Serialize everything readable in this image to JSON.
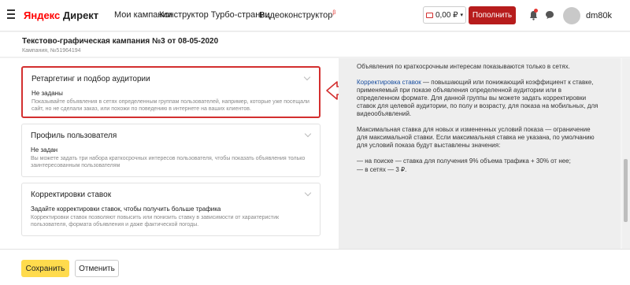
{
  "header": {
    "logo_brand": "Яндекс",
    "logo_product": "Директ",
    "nav": [
      "Мои кампании",
      "Конструктор Турбо-страниц",
      "Видеоконструктор"
    ],
    "nav_badge": "β",
    "balance": "0,00 ₽",
    "topup_label": "Пополнить",
    "username": "dm80k"
  },
  "campaign": {
    "title": "Текстово-графическая кампания №3 от 08-05-2020",
    "subtitle": "Кампания, №51964194"
  },
  "cards": [
    {
      "title": "Ретаргетинг и подбор аудитории",
      "status": "Не заданы",
      "desc": "Показывайте объявления в сетях определенным группам пользователей, например, которые уже посещали сайт, но не сделали заказ, или похожи по поведению в интернете на ваших клиентов."
    },
    {
      "title": "Профиль пользователя",
      "status": "Не задан",
      "desc": "Вы можете задать три набора краткосрочных интересов пользователя, чтобы показать объявления только заинтересованным пользователям"
    },
    {
      "title": "Корректировки ставок",
      "status": "Задайте корректировки ставок, чтобы получить больше трафика",
      "desc": "Корректировки ставок позволяют повысить или понизить ставку в зависимости от характеристик пользователя, формата объявления и даже фактической погоды."
    }
  ],
  "help": {
    "p1": "Объявления по краткосрочным интересам показываются только в сетях.",
    "p2_link": "Корректировка ставок",
    "p2_rest": " — повышающий или понижающий коэффициент к ставке, применяемый при показе объявления определенной аудитории или в определенном формате. Для данной группы вы можете задать корректировки ставок для целевой аудитории, по полу и возрасту, для показа на мобильных, для видеообъявлений.",
    "p3": "Максимальная ставка для новых и измененных условий показа — ограничение для максимальной ставки. Если максимальная ставка не указана, по умолчанию для условий показа будут выставлены значения:",
    "li1": "—    на поиске — ставка для получения 9% объема трафика + 30% от нее;",
    "li2": "—    в сетях — 3 ₽."
  },
  "footer": {
    "save_label": "Сохранить",
    "cancel_label": "Отменить"
  },
  "colors": {
    "highlight_red": "#d32f2f",
    "save_yellow": "#ffdb4d",
    "topup_red": "#b71c1c",
    "link_blue": "#1a4fa0"
  }
}
